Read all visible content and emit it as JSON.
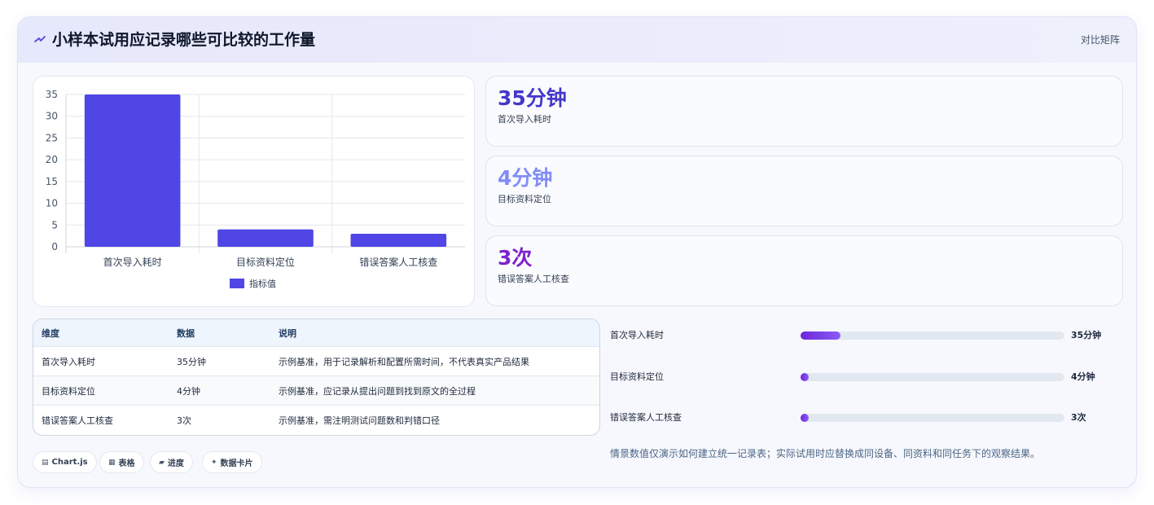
{
  "header": {
    "title": "小样本试用应记录哪些可比较的工作量",
    "tag": "对比矩阵",
    "icon": "spark-icon"
  },
  "chart_data": {
    "type": "bar",
    "categories": [
      "首次导入耗时",
      "目标资料定位",
      "错误答案人工核查"
    ],
    "series": [
      {
        "name": "指标值",
        "values": [
          35,
          4,
          3
        ],
        "color": "#4f46e5"
      }
    ],
    "ylim": [
      0,
      35
    ],
    "yticks": [
      0,
      5,
      10,
      15,
      20,
      25,
      30,
      35
    ],
    "legend": "bottom-center",
    "grid": true
  },
  "stats": [
    {
      "value": "35分钟",
      "label": "首次导入耗时",
      "color": "#4338ca"
    },
    {
      "value": "4分钟",
      "label": "目标资料定位",
      "color": "#818cf8"
    },
    {
      "value": "3次",
      "label": "错误答案人工核查",
      "color": "#7e22ce"
    }
  ],
  "table": {
    "headers": [
      "维度",
      "数据",
      "说明"
    ],
    "rows": [
      [
        "首次导入耗时",
        "35分钟",
        "示例基准，用于记录解析和配置所需时间，不代表真实产品结果"
      ],
      [
        "目标资料定位",
        "4分钟",
        "示例基准，应记录从提出问题到找到原文的全过程"
      ],
      [
        "错误答案人工核查",
        "3次",
        "示例基准，需注明测试问题数和判错口径"
      ]
    ]
  },
  "progress": [
    {
      "label": "首次导入耗时",
      "value": "35分钟",
      "fraction": 0.15
    },
    {
      "label": "目标资料定位",
      "value": "4分钟",
      "fraction": 0.03
    },
    {
      "label": "错误答案人工核查",
      "value": "3次",
      "fraction": 0.03
    }
  ],
  "note": "情景数值仅演示如何建立统一记录表；实际试用时应替换成同设备、同资料和同任务下的观察结果。",
  "pills": [
    {
      "icon": "▤",
      "label": "Chart.js"
    },
    {
      "icon": "▦",
      "label": "表格"
    },
    {
      "icon": "▰",
      "label": "进度"
    },
    {
      "icon": "✦",
      "label": "数据卡片"
    }
  ]
}
